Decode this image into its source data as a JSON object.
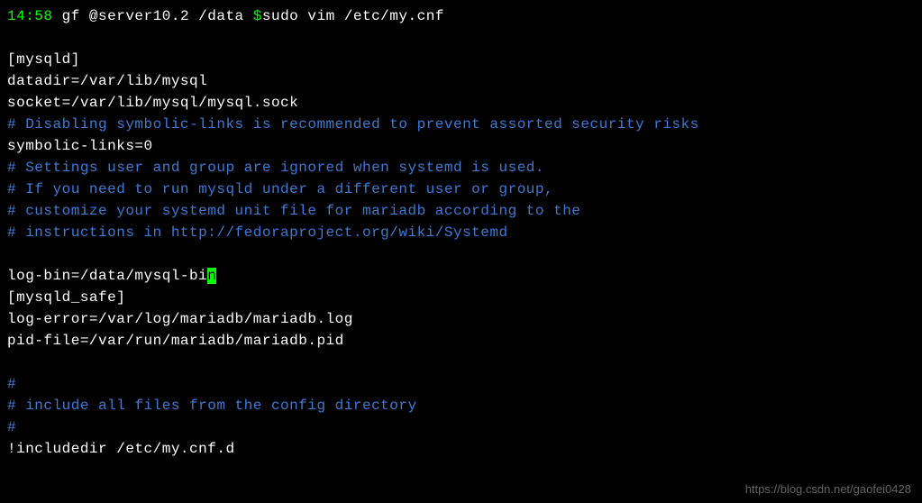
{
  "prompt": {
    "time": "14:58",
    "user_host": " gf @server10.2 /data ",
    "dollar": "$",
    "cmd": "sudo vim /etc/my.cnf"
  },
  "content": {
    "blank1": "",
    "section_mysqld": "[mysqld]",
    "datadir": "datadir=/var/lib/mysql",
    "socket": "socket=/var/lib/mysql/mysql.sock",
    "comment_symlinks": "# Disabling symbolic-links is recommended to prevent assorted security risks",
    "symbolic_links": "symbolic-links=0",
    "comment_settings1": "# Settings user and group are ignored when systemd is used.",
    "comment_settings2": "# If you need to run mysqld under a different user or group,",
    "comment_settings3": "# customize your systemd unit file for mariadb according to the",
    "comment_settings4": "# instructions in http://fedoraproject.org/wiki/Systemd",
    "blank2": "",
    "logbin_pre": "log-bin=/data/mysql-bi",
    "logbin_cursor": "n",
    "section_mysqld_safe": "[mysqld_safe]",
    "log_error": "log-error=/var/log/mariadb/mariadb.log",
    "pid_file": "pid-file=/var/run/mariadb/mariadb.pid",
    "blank3": "",
    "hash1": "#",
    "comment_include": "# include all files from the config directory",
    "hash2": "#",
    "includedir": "!includedir /etc/my.cnf.d"
  },
  "watermark": "https://blog.csdn.net/gaofei0428"
}
